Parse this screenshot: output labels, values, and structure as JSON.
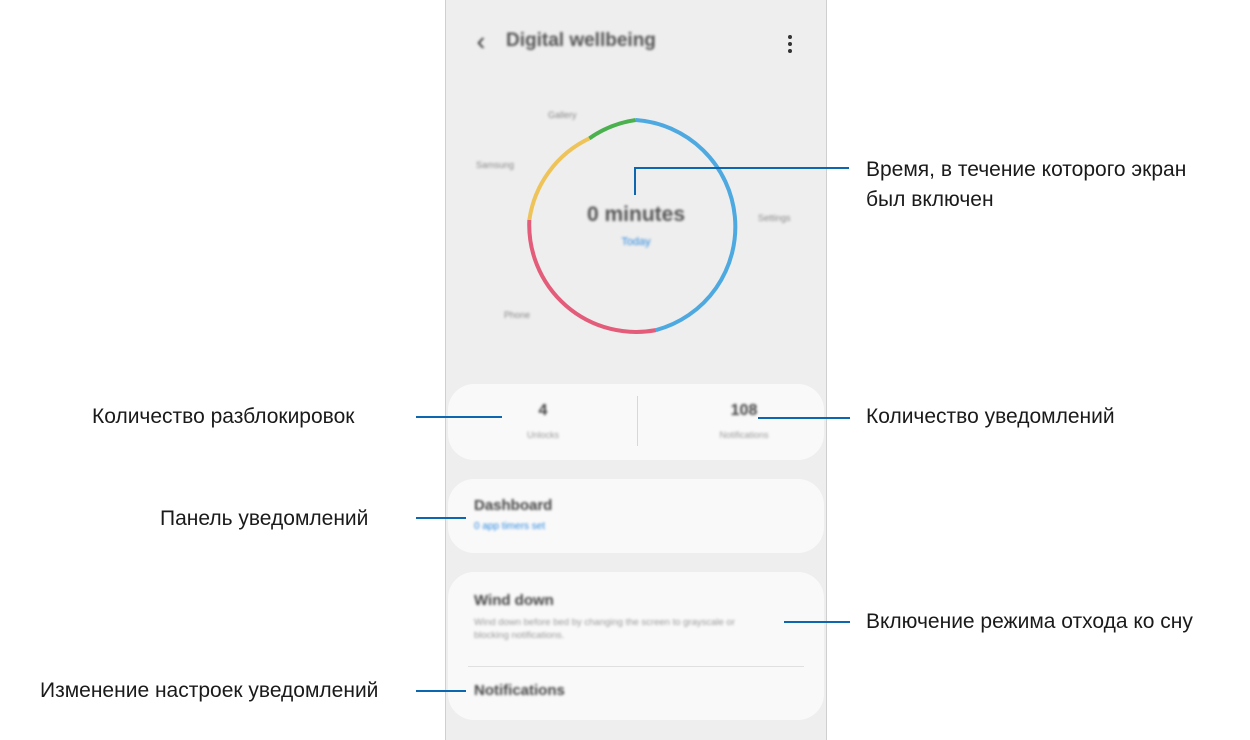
{
  "app": {
    "title": "Digital wellbeing"
  },
  "ring": {
    "screen_time": "0 minutes",
    "today_label": "Today",
    "segment_labels": [
      "Gallery",
      "Samsung",
      "Settings",
      "Phone"
    ]
  },
  "stats": {
    "unlocks_value": "4",
    "unlocks_label": "Unlocks",
    "notifications_value": "108",
    "notifications_label": "Notifications"
  },
  "dashboard": {
    "title": "Dashboard",
    "subtitle": "0 app timers set"
  },
  "wind_down": {
    "title": "Wind down",
    "description": "Wind down before bed by changing the screen to grayscale or blocking notifications."
  },
  "notifications_item": {
    "title": "Notifications"
  },
  "callouts": {
    "screen_time": "Время, в течение которого экран\nбыл включен",
    "unlocks": "Количество разблокировок",
    "notifications_count": "Количество уведомлений",
    "dashboard": "Панель уведомлений",
    "wind_down": "Включение режима отхода ко сну",
    "notification_settings": "Изменение настроек уведомлений"
  },
  "colors": {
    "accent": "#0d66b0",
    "link_blue": "#2f8be0",
    "ring_blue": "#4da9e0",
    "ring_green": "#4bb04e",
    "ring_yellow": "#eec45a",
    "ring_pink": "#e35c7a"
  }
}
